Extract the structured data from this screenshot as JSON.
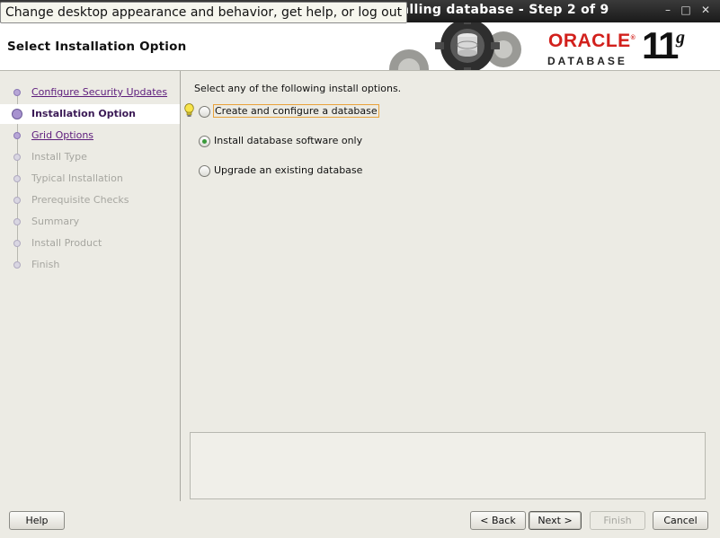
{
  "window": {
    "title": "Installing database - Step 2 of 9",
    "title_visible": "stalling database - Step 2 of 9",
    "controls": {
      "minimize": "–",
      "maximize": "□",
      "close": "✕"
    }
  },
  "tooltip": {
    "text": "Change desktop appearance and behavior, get help, or log out"
  },
  "header": {
    "page_title": "Select Installation Option",
    "logo": {
      "brand": "ORACLE",
      "reg": "®",
      "product": "DATABASE",
      "version": "11",
      "version_suffix": "g",
      "brand_color": "#d2201c"
    }
  },
  "steps": [
    {
      "label": "Configure Security Updates",
      "state": "done"
    },
    {
      "label": "Installation Option",
      "state": "current"
    },
    {
      "label": "Grid Options",
      "state": "done"
    },
    {
      "label": "Install Type",
      "state": "todo"
    },
    {
      "label": "Typical Installation",
      "state": "todo"
    },
    {
      "label": "Prerequisite Checks",
      "state": "todo"
    },
    {
      "label": "Summary",
      "state": "todo"
    },
    {
      "label": "Install Product",
      "state": "todo"
    },
    {
      "label": "Finish",
      "state": "todo"
    }
  ],
  "main": {
    "instruction": "Select any of the following install options.",
    "options": [
      {
        "label": "Create and configure a database",
        "selected": false,
        "focused": true
      },
      {
        "label": "Install database software only",
        "selected": true,
        "focused": false
      },
      {
        "label": "Upgrade an existing database",
        "selected": false,
        "focused": false
      }
    ],
    "message": ""
  },
  "buttons": {
    "help": "Help",
    "back": "< Back",
    "next": "Next >",
    "finish": "Finish",
    "cancel": "Cancel"
  },
  "colors": {
    "accent_purple": "#5d1c7c",
    "radio_selected": "#3a9a3a",
    "focus_outline": "#e8a23a"
  }
}
